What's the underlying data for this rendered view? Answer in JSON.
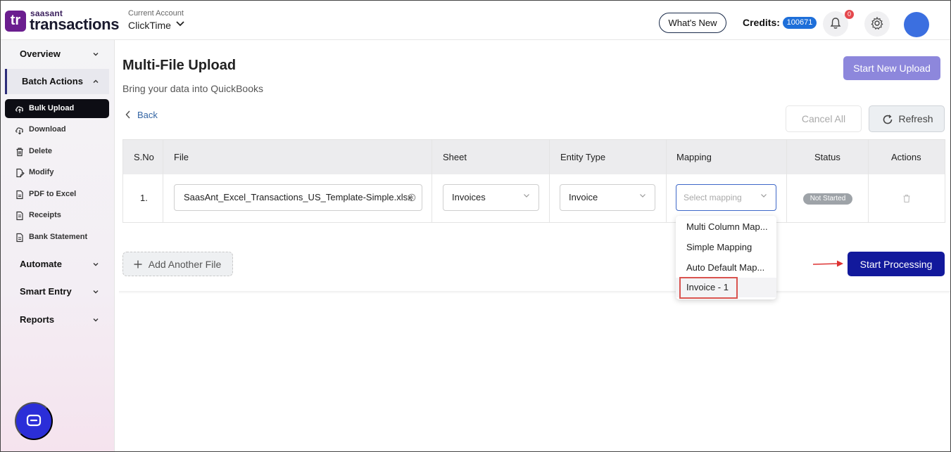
{
  "brand": {
    "small": "saasant",
    "big": "transactions",
    "mark": "tr"
  },
  "account": {
    "label": "Current Account",
    "name": "ClickTime"
  },
  "header": {
    "whats_new": "What's New",
    "credits_label": "Credits:",
    "credits_value": "100671",
    "notifications": "0"
  },
  "sidebar": {
    "overview": "Overview",
    "batch_actions": "Batch Actions",
    "items": [
      "Bulk Upload",
      "Download",
      "Delete",
      "Modify",
      "PDF to Excel",
      "Receipts",
      "Bank Statement"
    ],
    "automate": "Automate",
    "smart_entry": "Smart Entry",
    "reports": "Reports"
  },
  "main": {
    "title": "Multi-File Upload",
    "subtitle": "Bring your data into QuickBooks",
    "start_new": "Start New Upload",
    "back": "Back",
    "cancel_all": "Cancel All",
    "refresh": "Refresh",
    "add_file": "Add Another File",
    "start_processing": "Start Processing"
  },
  "table": {
    "headers": [
      "S.No",
      "File",
      "Sheet",
      "Entity Type",
      "Mapping",
      "Status",
      "Actions"
    ],
    "row": {
      "no": "1.",
      "file": "SaasAnt_Excel_Transactions_US_Template-Simple.xlsx",
      "sheet": "Invoices",
      "entity": "Invoice",
      "mapping_placeholder": "Select mapping",
      "status": "Not Started"
    }
  },
  "mapping_options": [
    "Multi Column Map...",
    "Simple Mapping",
    "Auto Default Map...",
    "Invoice - 1"
  ],
  "colors": {
    "accent": "#12199c",
    "brand": "#6b1e8f",
    "highlight": "#d9534f",
    "credits": "#1e6fd9"
  }
}
